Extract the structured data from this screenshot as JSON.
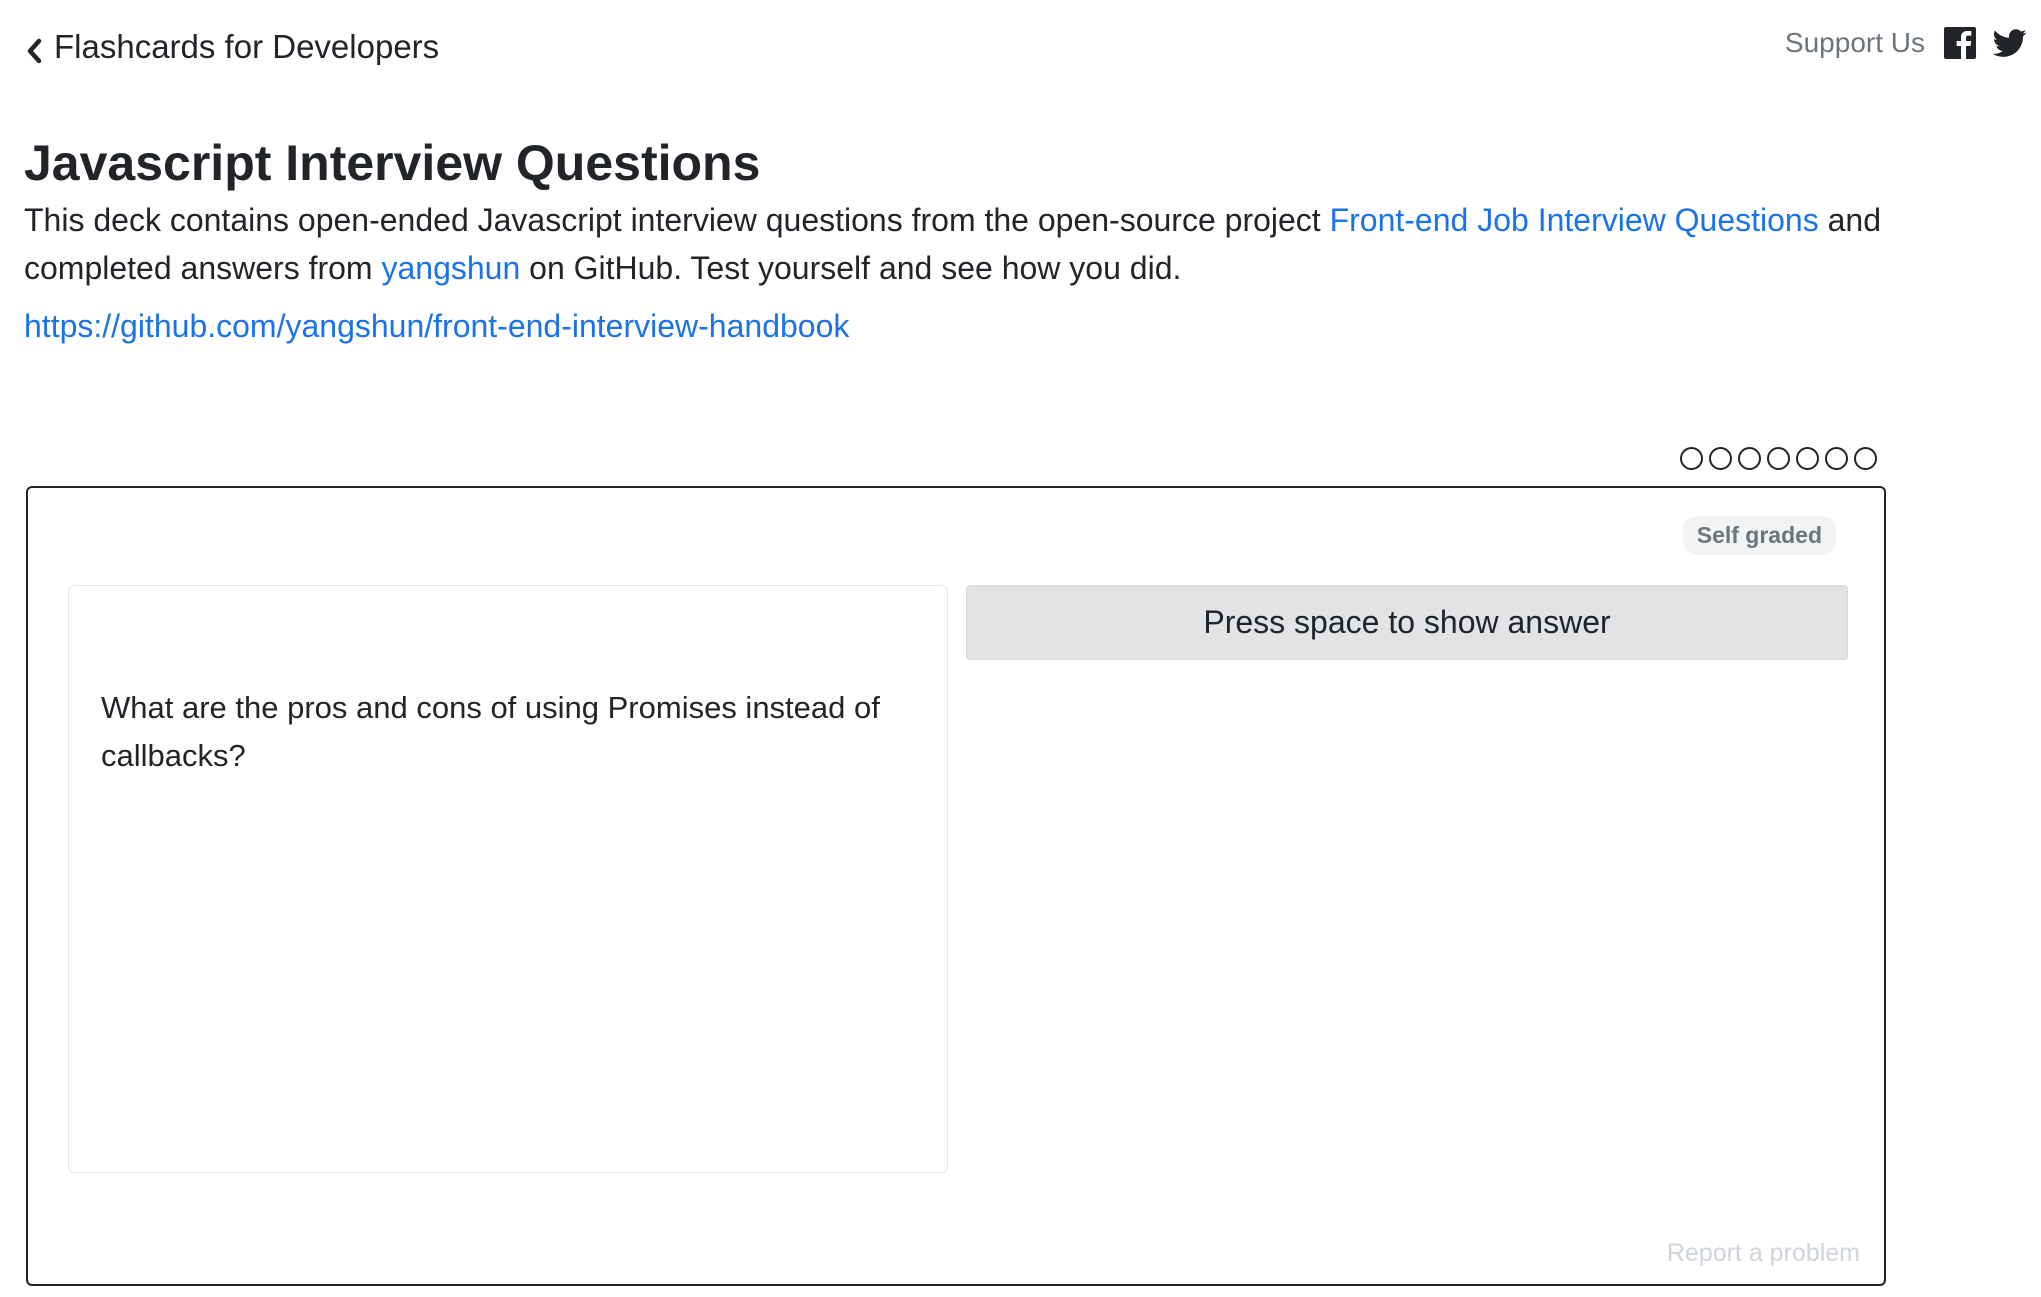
{
  "nav": {
    "back_label": "Flashcards for Developers",
    "support_label": "Support Us",
    "icons": [
      "chevron-left-icon",
      "facebook-icon",
      "twitter-icon"
    ]
  },
  "header": {
    "title": "Javascript Interview Questions",
    "description_part1": "This deck contains open-ended Javascript interview questions from the open-source project ",
    "description_link1": "Front-end Job Interview Questions",
    "description_part2": " and completed answers from ",
    "description_link2": "yangshun",
    "description_part3": " on GitHub. Test yourself and see how you did.",
    "repo_url": "https://github.com/yangshun/front-end-interview-handbook"
  },
  "progress": {
    "total": 7,
    "completed": 0
  },
  "card": {
    "badge": "Self graded",
    "question": "What are the pros and cons of using Promises instead of callbacks?",
    "show_answer_label": "Press space to show answer",
    "report_label": "Report a problem"
  },
  "colors": {
    "text": "#212529",
    "link": "#1a73e8",
    "muted": "#6c757d",
    "button_bg": "#e2e3e5",
    "faint": "#ced4da"
  }
}
